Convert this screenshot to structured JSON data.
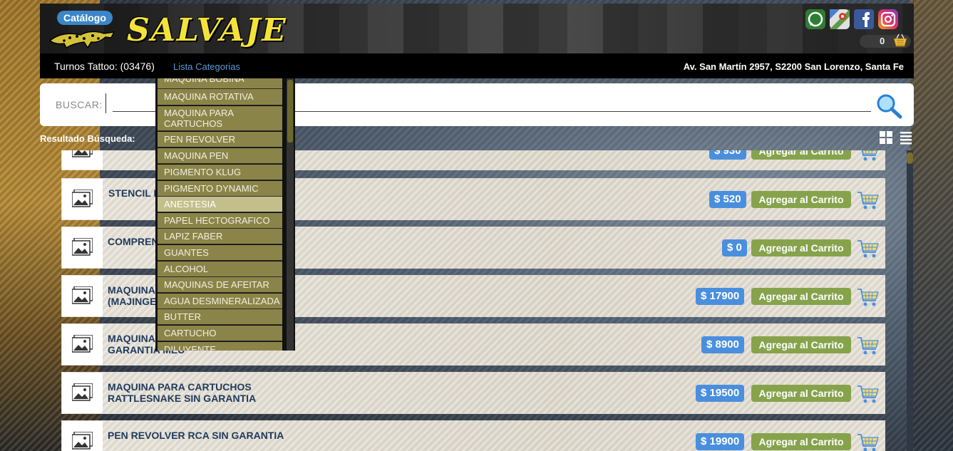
{
  "header": {
    "badge": "Catálogo",
    "logo_text": "SALVAJE",
    "social_icons": [
      "whatsapp-icon",
      "google-maps-icon",
      "facebook-icon",
      "instagram-icon"
    ],
    "cart_count": "0"
  },
  "nav": {
    "turnos": "Turnos Tattoo: (03476)",
    "lista": "Lista Categorias",
    "address": "Av. San Martín 2957, S2200 San Lorenzo, Santa Fe"
  },
  "search": {
    "label": "BUSCAR:",
    "value": ""
  },
  "results": {
    "heading": "Resultado Búsqueda:",
    "add_label": "Agregar al Carrito",
    "items": [
      {
        "name": "",
        "price": "$ 930"
      },
      {
        "name": "STENCIL R",
        "price": "$ 520"
      },
      {
        "name": "COMPREN",
        "price": "$ 0"
      },
      {
        "name": "MAQUINA\n(MAJINGE",
        "price": "$ 17900"
      },
      {
        "name": "MAQUINA\nGARANTIA MEU",
        "price": "$ 8900"
      },
      {
        "name": "MAQUINA PARA CARTUCHOS\nRATTLESNAKE SIN GARANTIA",
        "price": "$ 19500"
      },
      {
        "name": "PEN REVOLVER RCA SIN GARANTIA",
        "price": "$ 19900"
      }
    ]
  },
  "categories": {
    "items": [
      "MAQUINA BOBINA",
      "MAQUINA ROTATIVA",
      "MAQUINA PARA CARTUCHOS",
      "PEN REVOLVER",
      "MAQUINA PEN",
      "PIGMENTO KLUG",
      "PIGMENTO DYNAMIC",
      "ANESTESIA",
      "PAPEL HECTOGRAFICO",
      "LAPIZ FABER",
      "GUANTES",
      "ALCOHOL",
      "MAQUINAS DE AFEITAR",
      "AGUA DESMINERALIZADA",
      "BUTTER",
      "CARTUCHO",
      "DILUYENTE"
    ],
    "active": "ANESTESIA"
  },
  "colors": {
    "accent_blue": "#4a8fdd",
    "add_green": "#86a34c",
    "category_bg": "#8b8449",
    "logo_yellow": "#f3e23a"
  }
}
